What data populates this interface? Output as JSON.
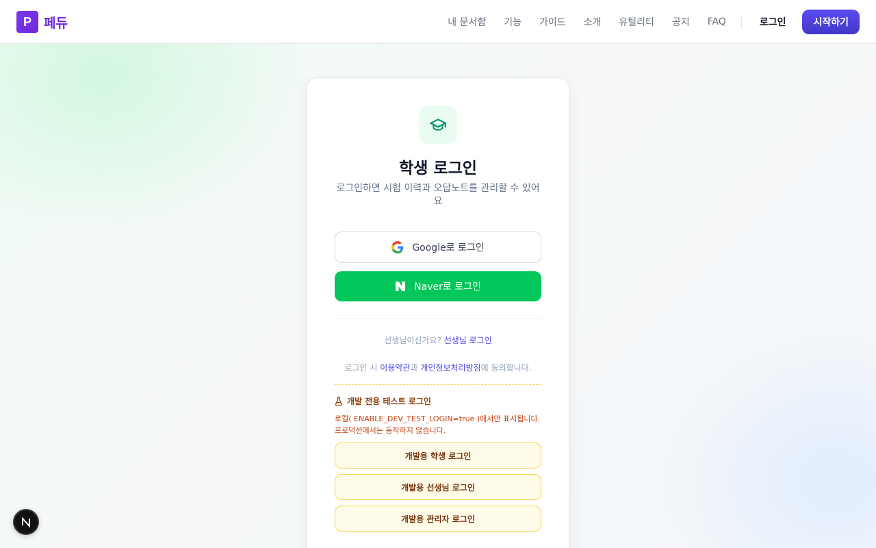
{
  "header": {
    "logo_letter": "P",
    "logo_text": "페듀",
    "nav": [
      "내 문서함",
      "기능",
      "가이드",
      "소개",
      "유틸리티",
      "공지",
      "FAQ"
    ],
    "login": "로그인",
    "start": "시작하기"
  },
  "card": {
    "icon": "graduation-cap-icon",
    "title": "학생 로그인",
    "subtitle": "로그인하면 시험 이력과 오답노트를 관리할 수 있어요",
    "google_label": "Google로 로그인",
    "naver_label": "Naver로 로그인",
    "teacher_prompt": "선생님이신가요?",
    "teacher_link": "선생님 로그인",
    "terms_prefix": "로그인 시",
    "terms_link": "이용약관",
    "terms_and": "과",
    "privacy_link": "개인정보처리방침",
    "terms_suffix": "에 동의합니다."
  },
  "dev": {
    "title": "개발 전용 테스트 로그인",
    "description": "로컬( ENABLE_DEV_TEST_LOGIN=true )에서만 표시됩니다. 프로덕션에서는 동작하지 않습니다.",
    "buttons": [
      "개발용 학생 로그인",
      "개발용 선생님 로그인",
      "개발용 관리자 로그인"
    ]
  },
  "fab": {
    "label": "N"
  },
  "colors": {
    "brand": "#6d28d9",
    "primary": "#4f46e5",
    "naver": "#03c75a",
    "dev_accent": "#fcd34d"
  }
}
